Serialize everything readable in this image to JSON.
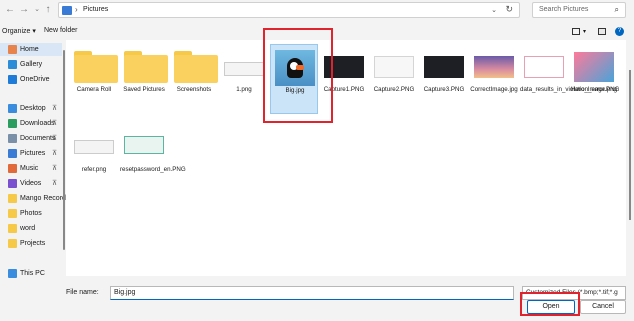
{
  "address": {
    "path": "Pictures",
    "separator": "›"
  },
  "search": {
    "placeholder": "Search Pictures"
  },
  "toolbar": {
    "organize": "Organize ▾",
    "new_folder": "New folder"
  },
  "sidebar": [
    {
      "label": "Home",
      "icon": "home-icon",
      "color": "#e8834b",
      "selected": true
    },
    {
      "label": "Gallery",
      "icon": "gallery-icon",
      "color": "#2b8cd8"
    },
    {
      "label": "OneDrive",
      "icon": "cloud-icon",
      "color": "#1f7bd8"
    },
    {
      "label": "Desktop",
      "icon": "desktop-icon",
      "color": "#3a8dde"
    },
    {
      "label": "Downloads",
      "icon": "download-icon",
      "color": "#2a9d5f"
    },
    {
      "label": "Documents",
      "icon": "documents-icon",
      "color": "#7a8fa8"
    },
    {
      "label": "Pictures",
      "icon": "pictures-icon",
      "color": "#3a7bd5"
    },
    {
      "label": "Music",
      "icon": "music-icon",
      "color": "#e26a3a"
    },
    {
      "label": "Videos",
      "icon": "videos-icon",
      "color": "#7a4fd0"
    },
    {
      "label": "Mango Recorde",
      "icon": "folder-icon",
      "color": "#f7c948"
    },
    {
      "label": "Photos",
      "icon": "folder-icon",
      "color": "#f7c948"
    },
    {
      "label": "word",
      "icon": "folder-icon",
      "color": "#f7c948"
    },
    {
      "label": "Projects",
      "icon": "folder-icon",
      "color": "#f7c948"
    },
    {
      "label": "This PC",
      "icon": "pc-icon",
      "color": "#3a8dde"
    }
  ],
  "files": [
    {
      "name": "Camera Roll",
      "kind": "folder"
    },
    {
      "name": "Saved Pictures",
      "kind": "folder"
    },
    {
      "name": "Screenshots",
      "kind": "folder"
    },
    {
      "name": "1.png",
      "kind": "doc"
    },
    {
      "name": "Big.jpg",
      "kind": "puffin",
      "selected": true
    },
    {
      "name": "Capture1.PNG",
      "kind": "dark"
    },
    {
      "name": "Capture2.PNG",
      "kind": "light"
    },
    {
      "name": "Capture3.PNG",
      "kind": "dark"
    },
    {
      "name": "CorrectImage.jpg",
      "kind": "sunset"
    },
    {
      "name": "data_results_in_violation_error.PNG",
      "kind": "pinkdoc"
    },
    {
      "name": "Hero_Image.png",
      "kind": "hero"
    },
    {
      "name": "refer.png",
      "kind": "doc"
    },
    {
      "name": "resetpassword_en.PNG",
      "kind": "tealdoc"
    }
  ],
  "bottom": {
    "file_name_label": "File name:",
    "file_name_value": "Big.jpg",
    "filter": "Customized Files (*.bmp;*.tif;*.g",
    "open": "Open",
    "cancel": "Cancel"
  }
}
